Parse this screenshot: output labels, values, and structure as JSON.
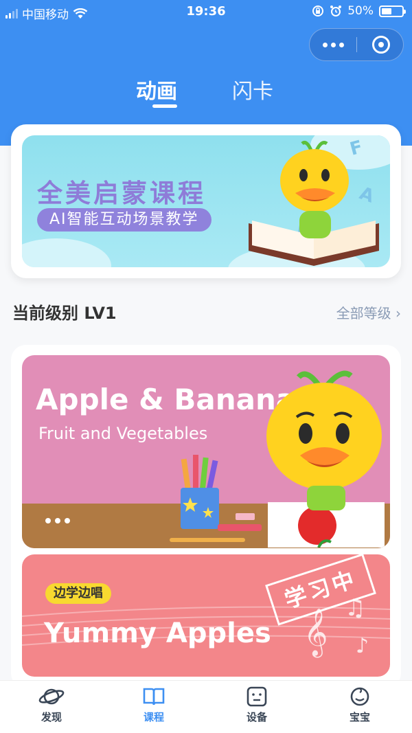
{
  "status_bar": {
    "carrier": "中国移动",
    "time": "19:36",
    "battery": "50%",
    "battery_level": 0.5
  },
  "capsule": {
    "more_icon": "more-dots-icon",
    "close_icon": "target-circle-icon"
  },
  "tabs": [
    {
      "label": "动画",
      "active": true
    },
    {
      "label": "闪卡",
      "active": false
    }
  ],
  "banner": {
    "title": "全美启蒙课程",
    "subtitle": "AI智能互动场景教学",
    "letters": [
      "F",
      "A",
      "A"
    ]
  },
  "level": {
    "title": "当前级别 LV1",
    "all_link": "全部等级"
  },
  "courses": [
    {
      "name": "Apple & Banana",
      "subtitle": "Fruit and Vegetables",
      "color": "#e18eb7"
    },
    {
      "tag": "边学边唱",
      "name": "Yummy Apples",
      "stamp": "学习中",
      "color": "#f3868a"
    }
  ],
  "nav": [
    {
      "label": "发现",
      "icon": "planet-icon",
      "active": false
    },
    {
      "label": "课程",
      "icon": "book-icon",
      "active": true
    },
    {
      "label": "设备",
      "icon": "device-icon",
      "active": false
    },
    {
      "label": "宝宝",
      "icon": "baby-face-icon",
      "active": false
    }
  ],
  "colors": {
    "primary": "#3d8ff2",
    "banner_title": "#8e7cd8",
    "tag_yellow": "#f8d930"
  }
}
